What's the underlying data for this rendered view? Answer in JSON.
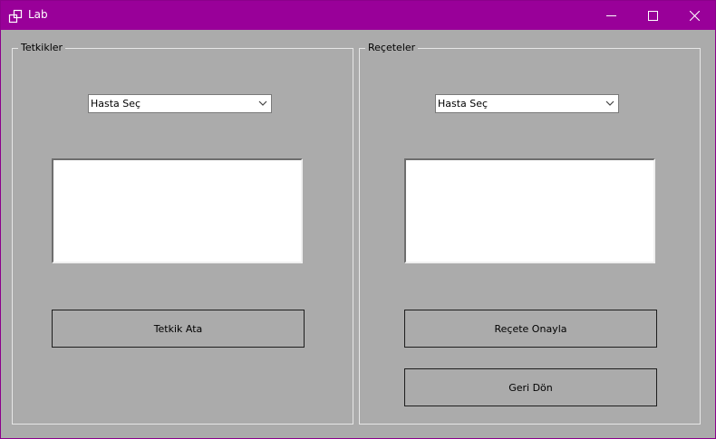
{
  "window": {
    "title": "Lab"
  },
  "titlebar": {
    "icons": [
      "app-icon",
      "minimize-icon",
      "maximize-icon",
      "close-icon"
    ]
  },
  "left_group": {
    "legend": "Tetkikler",
    "combo_value": "Hasta Seç",
    "button_label": "Tetkik Ata"
  },
  "right_group": {
    "legend": "Reçeteler",
    "combo_value": "Hasta Seç",
    "approve_label": "Reçete Onayla",
    "back_label": "Geri Dön"
  },
  "colors": {
    "titlebar": "#990099",
    "background": "#ababab"
  }
}
